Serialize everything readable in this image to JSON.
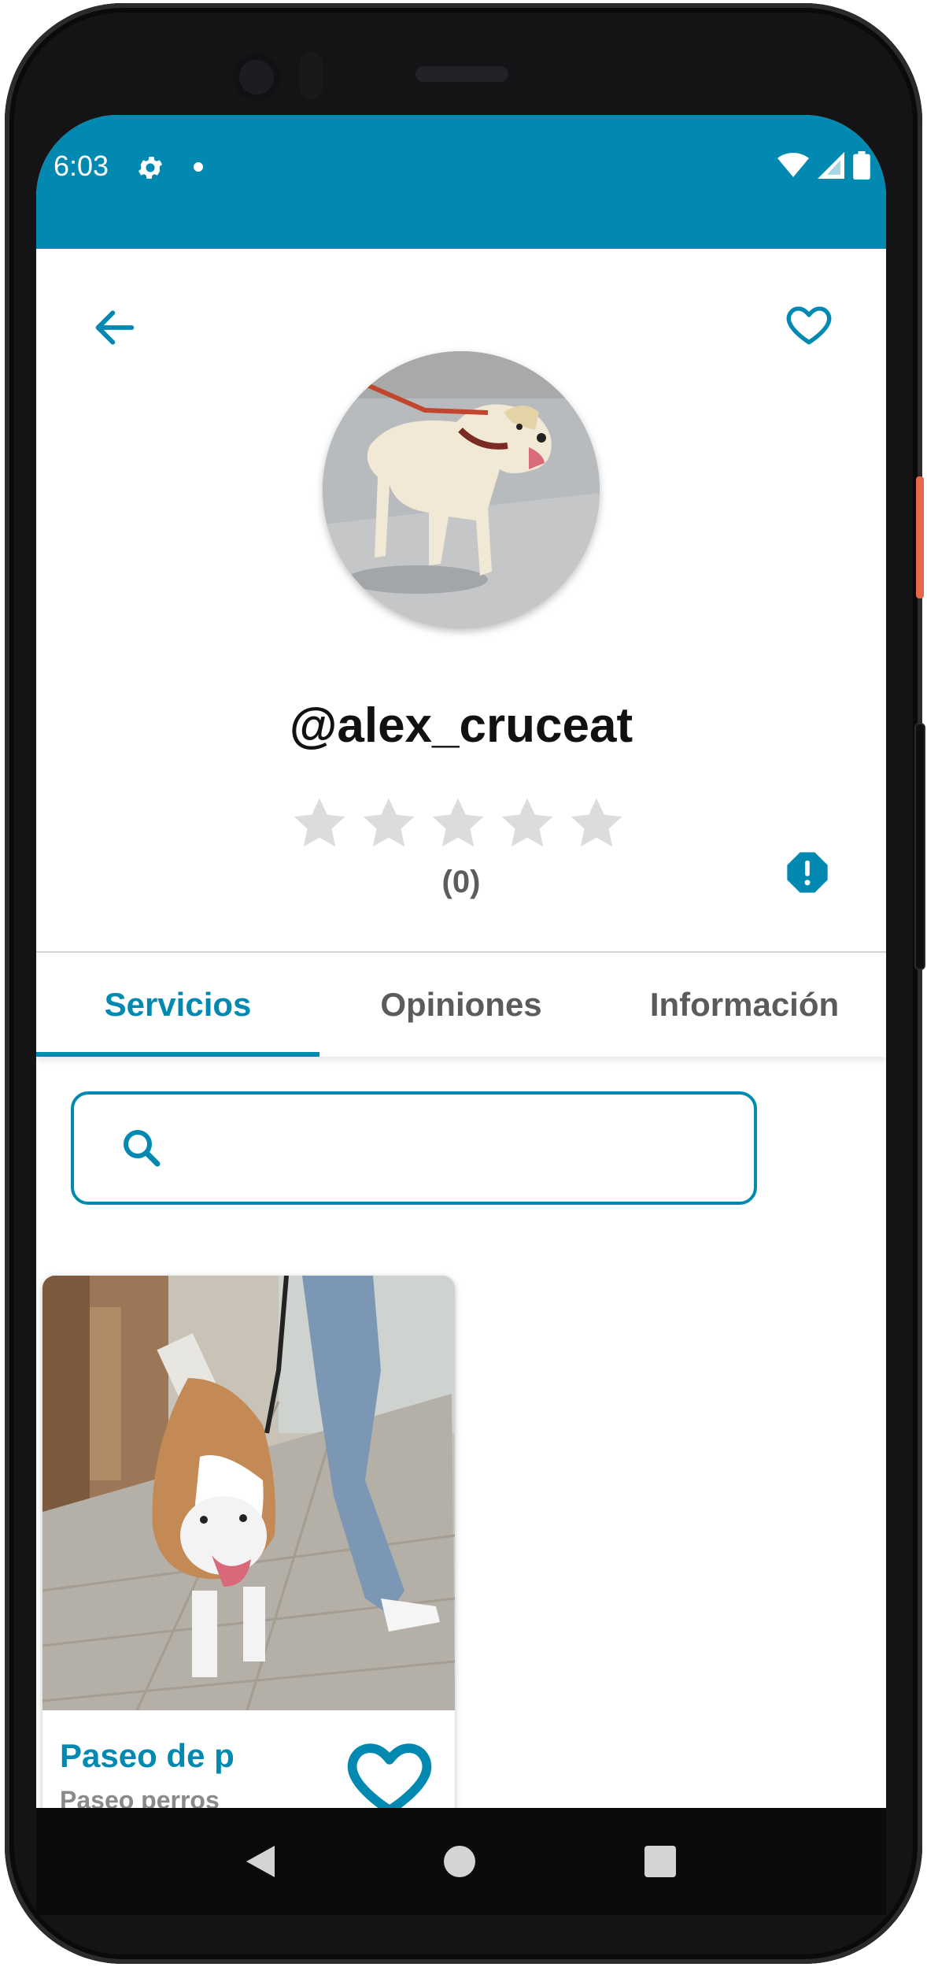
{
  "status_bar": {
    "time": "6:03",
    "background": "#0189b2",
    "icons": [
      "gear-icon",
      "dot-icon",
      "wifi-icon",
      "signal-icon",
      "battery-icon"
    ]
  },
  "app_bar": {
    "back_icon": "arrow-left-icon",
    "favorite_icon": "heart-outline-icon"
  },
  "profile": {
    "avatar": "dog-photo",
    "username": "@alex_cruceat",
    "rating_stars": 5,
    "rating_value": 0,
    "rating_count": "(0)",
    "report_icon": "alert-badge-icon"
  },
  "tabs": [
    {
      "label": "Servicios",
      "active": true
    },
    {
      "label": "Opiniones",
      "active": false
    },
    {
      "label": "Información",
      "active": false
    }
  ],
  "search": {
    "value": "",
    "placeholder": "",
    "icon": "search-icon"
  },
  "services": [
    {
      "title": "Paseo de p",
      "subtitle": "Paseo perros",
      "image": "bulldog-walk-photo",
      "favorite_icon": "heart-outline-icon"
    }
  ],
  "colors": {
    "accent": "#0189b2",
    "star_empty": "#dcdcdc",
    "text_primary": "#111111",
    "text_secondary": "#5b5b5b"
  },
  "nav_bar": {
    "icons": [
      "nav-back-icon",
      "nav-home-icon",
      "nav-recents-icon"
    ]
  }
}
